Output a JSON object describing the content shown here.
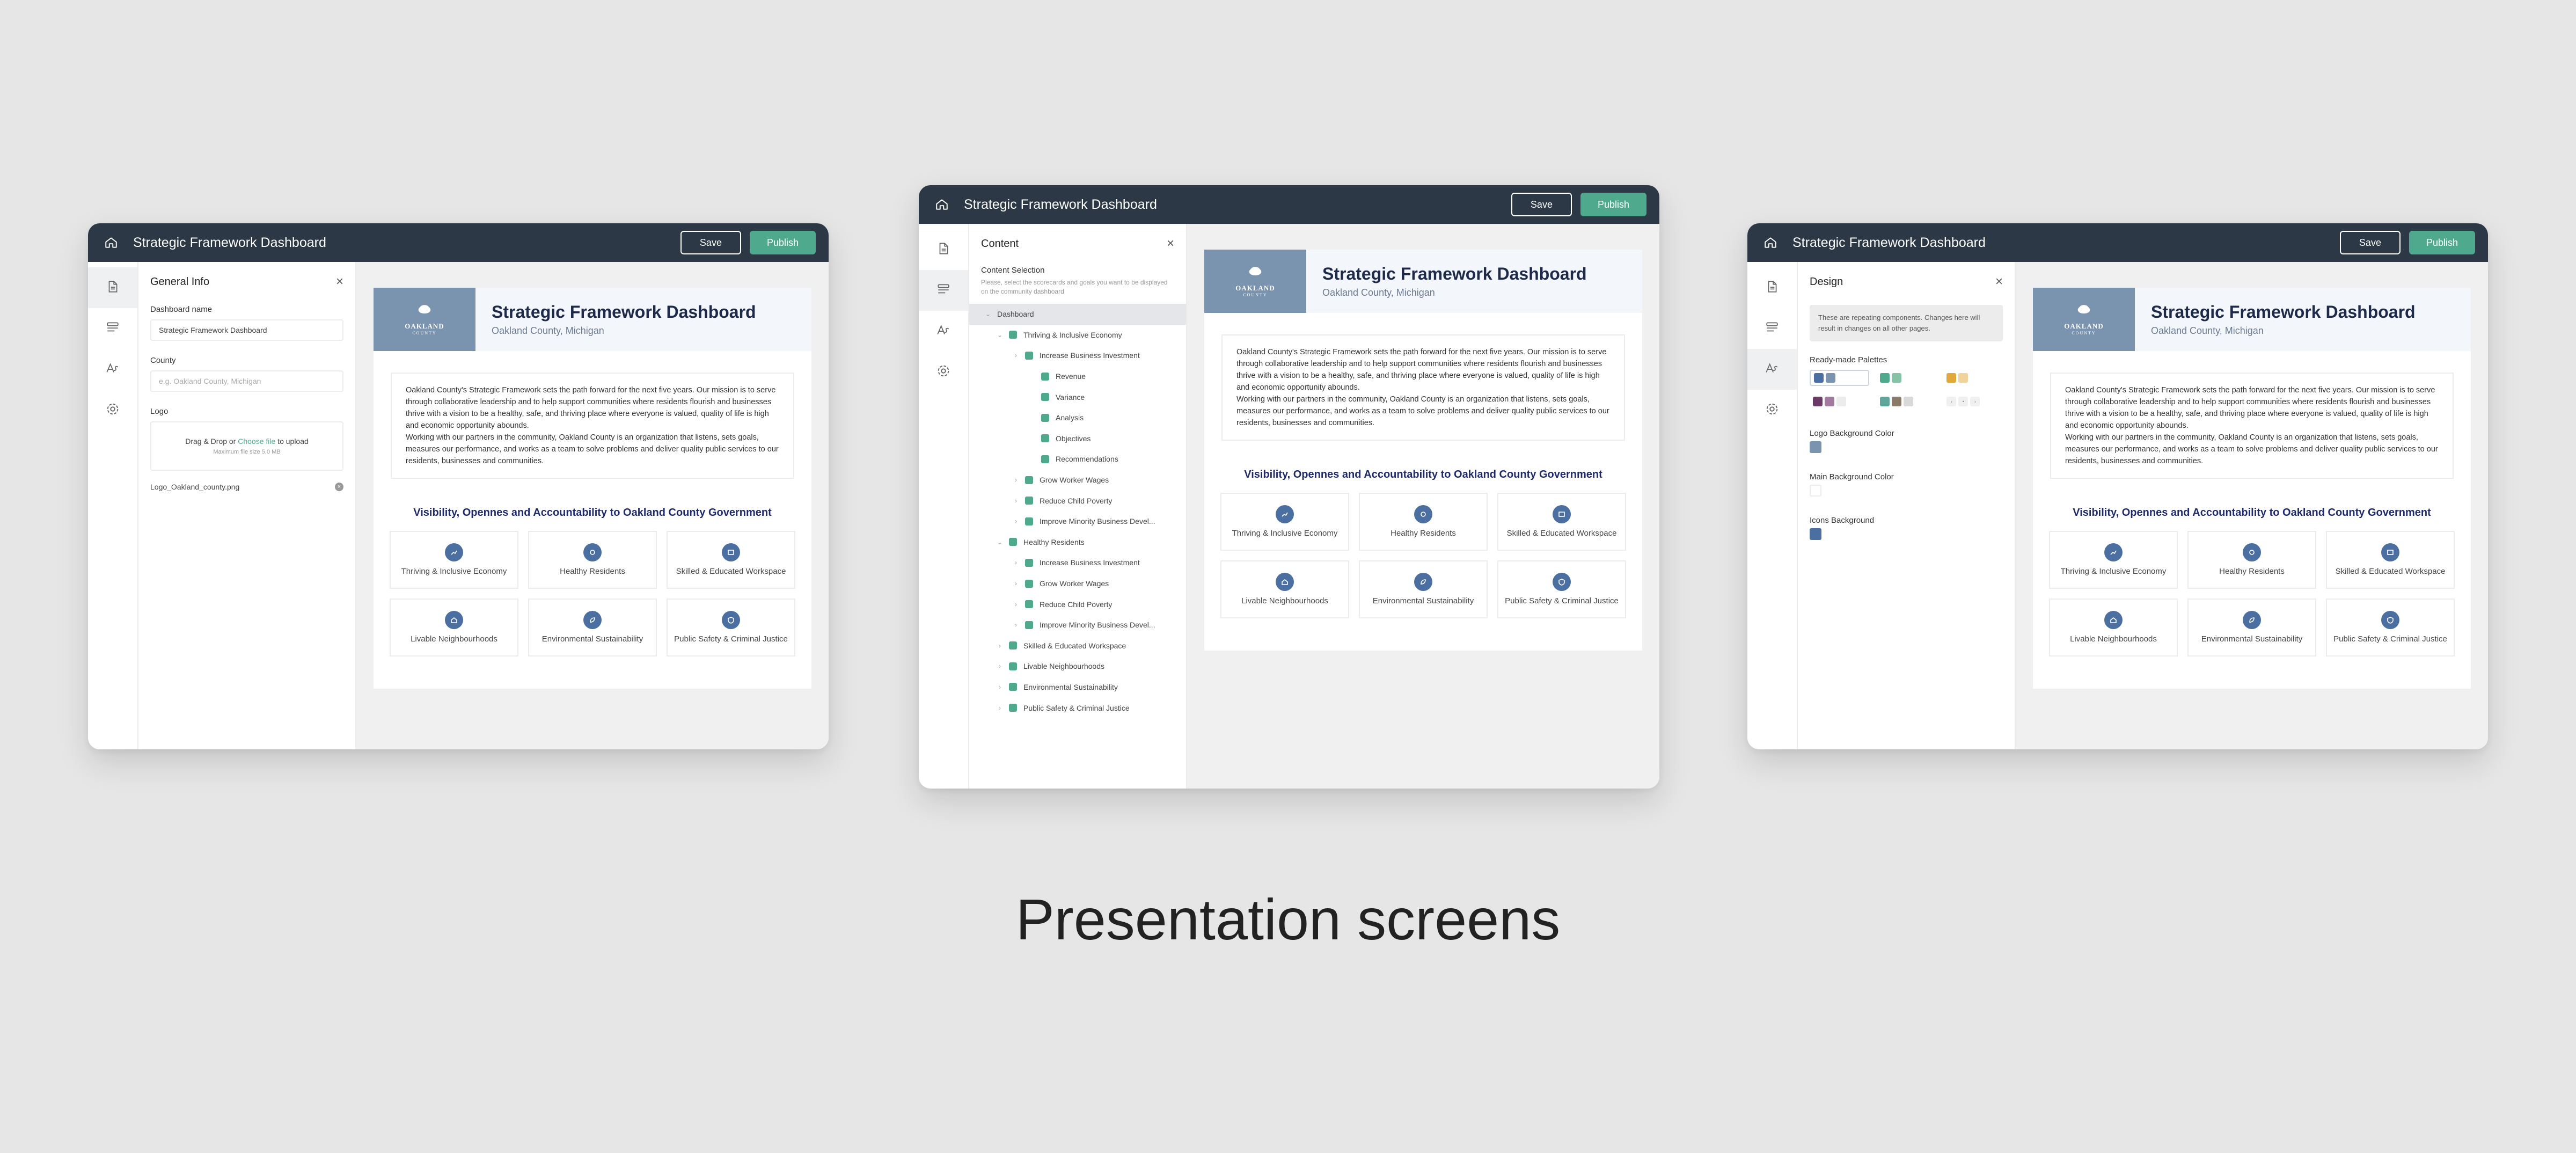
{
  "app": {
    "title": "Strategic Framework Dashboard",
    "save_label": "Save",
    "publish_label": "Publish"
  },
  "colors": {
    "topbar": "#2c3845",
    "accent": "#4fa98c",
    "icon_bg": "#4b6fa1",
    "logo_bg": "#7a93ae"
  },
  "rail_icons": [
    "document-icon",
    "content-list-icon",
    "design-font-icon",
    "settings-icon"
  ],
  "preview": {
    "title": "Strategic Framework Dashboard",
    "subtitle": "Oakland County, Michigan",
    "logo_text_1": "OAKLAND",
    "logo_text_2": "COUNTY",
    "description_1": "Oakland County's Strategic Framework sets the path forward for the next five years. Our mission is to serve through collaborative leadership and to help support communities where residents flourish and businesses thrive with a vision to be a healthy, safe, and thriving place where everyone is valued, quality of life is high and economic opportunity abounds.",
    "description_2": "Working with our partners in the community, Oakland County is an organization that listens, sets goals, measures our performance, and works as a team to solve problems and deliver quality public services to our residents, businesses and communities.",
    "section_title": "Visibility, Opennes and Accountability to Oakland County Government",
    "tiles": [
      "Thriving & Inclusive Economy",
      "Healthy Residents",
      "Skilled & Educated Workspace",
      "Livable Neighbourhoods",
      "Environmental Sustainability",
      "Public Safety & Criminal Justice"
    ]
  },
  "general_info": {
    "panel_title": "General Info",
    "close": "×",
    "name_label": "Dashboard name",
    "name_value": "Strategic Framework Dashboard",
    "county_label": "County",
    "county_placeholder": "e.g. Oakland County, Michigan",
    "logo_label": "Logo",
    "drop_text": "Drag & Drop or",
    "drop_link": "Choose file",
    "drop_suffix": "to upload",
    "drop_hint": "Maximum file size 5,0 MB",
    "file_name": "Logo_Oakland_county.png"
  },
  "content": {
    "panel_title": "Content",
    "close": "×",
    "section_title": "Content Selection",
    "hint": "Please, select the scorecards and goals you want to be displayed on the community dashboard",
    "tree": [
      {
        "label": "Dashboard",
        "level": 0,
        "chev": "⌄",
        "check": false
      },
      {
        "label": "Thriving & Inclusive Economy",
        "level": 1,
        "chev": "⌄",
        "check": true
      },
      {
        "label": "Increase Business Investment",
        "level": 2,
        "chev": "›",
        "check": true
      },
      {
        "label": "Revenue",
        "level": 3,
        "chev": "",
        "check": true
      },
      {
        "label": "Variance",
        "level": 3,
        "chev": "",
        "check": true
      },
      {
        "label": "Analysis",
        "level": 3,
        "chev": "",
        "check": true
      },
      {
        "label": "Objectives",
        "level": 3,
        "chev": "",
        "check": true
      },
      {
        "label": "Recommendations",
        "level": 3,
        "chev": "",
        "check": true
      },
      {
        "label": "Grow Worker Wages",
        "level": 2,
        "chev": "›",
        "check": true
      },
      {
        "label": "Reduce Child Poverty",
        "level": 2,
        "chev": "›",
        "check": true
      },
      {
        "label": "Improve Minority Business Devel...",
        "level": 2,
        "chev": "›",
        "check": true
      },
      {
        "label": "Healthy Residents",
        "level": 1,
        "chev": "⌄",
        "check": true
      },
      {
        "label": "Increase Business Investment",
        "level": 2,
        "chev": "›",
        "check": true
      },
      {
        "label": "Grow Worker Wages",
        "level": 2,
        "chev": "›",
        "check": true
      },
      {
        "label": "Reduce Child Poverty",
        "level": 2,
        "chev": "›",
        "check": true
      },
      {
        "label": "Improve Minority Business Devel...",
        "level": 2,
        "chev": "›",
        "check": true
      },
      {
        "label": "Skilled & Educated Workspace",
        "level": 1,
        "chev": "›",
        "check": true
      },
      {
        "label": "Livable Neighbourhoods",
        "level": 1,
        "chev": "›",
        "check": true
      },
      {
        "label": "Environmental Sustainability",
        "level": 1,
        "chev": "›",
        "check": true
      },
      {
        "label": "Public Safety & Criminal Justice",
        "level": 1,
        "chev": "›",
        "check": true
      }
    ]
  },
  "design": {
    "panel_title": "Design",
    "close": "×",
    "note": "These are repeating components. Changes here will result in changes on all other pages.",
    "palettes_label": "Ready-made Palettes",
    "palettes": [
      [
        "#4b6fa1",
        "#7a93ae"
      ],
      [
        "#4fa98c",
        "#86c2a6"
      ],
      [
        "#e0a93a",
        "#efd39a"
      ],
      [
        "#6c3a66",
        "#a27aa0",
        "#ececec"
      ],
      [
        "#5fa79a",
        "#8a7a6a",
        "#d9d9d9"
      ]
    ],
    "logo_bg_label": "Logo Background Color",
    "logo_bg_color": "#7a93ae",
    "main_bg_label": "Main Background Color",
    "main_bg_color": "#ffffff",
    "icons_bg_label": "Icons Background",
    "icons_bg_color": "#4b6fa1"
  },
  "caption": "Presentation screens"
}
